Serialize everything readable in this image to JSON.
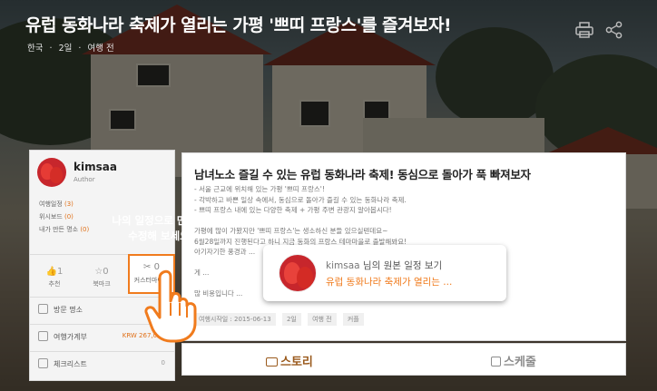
{
  "header": {
    "title": "유럽 동화나라 축제가 열리는 가평 '쁘띠 프랑스'를 즐겨보자!",
    "meta": [
      "한국",
      "·",
      "2일",
      "·",
      "여행 전"
    ]
  },
  "profile": {
    "name": "kimsaa",
    "role": "Author",
    "links": [
      {
        "label": "여행일정",
        "count": "(3)"
      },
      {
        "label": "위시보드",
        "count": "(0)"
      },
      {
        "label": "내가 만든 명소",
        "count": "(0)"
      }
    ],
    "stats": [
      {
        "icon": "like-icon",
        "glyph": "👍",
        "value": "1",
        "label": "추천"
      },
      {
        "icon": "bookmark-icon",
        "glyph": "☆",
        "value": "0",
        "label": "북마크"
      }
    ],
    "customize": {
      "icon": "scissors-icon",
      "glyph": "✂",
      "value": "0",
      "label": "커스터마이즈"
    },
    "rows": [
      {
        "icon": "pin-icon",
        "label": "방문 명소",
        "value": ""
      },
      {
        "icon": "wallet-icon",
        "label": "여행가계부",
        "value": "KRW 267,000"
      },
      {
        "icon": "checklist-icon",
        "label": "체크리스트",
        "value": "0"
      }
    ]
  },
  "article": {
    "title": "남녀노소 즐길 수 있는 유럽 동화나라 축제! 동심으로 돌아가 푹 빠져보자",
    "body": [
      "- 서울 근교에 위치해 있는 가평 '쁘띠 프랑스'!",
      "- 각박하고 바쁜 일상 속에서, 동심으로 돌아가 즐길 수 있는 동화나라 축제.",
      "- 쁘띠 프랑스 내에 있는 다양한 축제 + 가평 주변 관광지 알아봅시다!",
      "",
      "가평에 많이 가봤지만 '쁘띠 프랑스'는 생소하신 분들 있으실텐데요~",
      "6월28일까지 진행된다고 하니 지금 동화의 프랑스 테마마을로 출발해봐요!",
      "아기자기한 풍경과 ...",
      "",
      "게 ...",
      "",
      "많 비용입니다 ..."
    ],
    "tags": [
      "여행시작일 : 2015-06-13",
      "2일",
      "여행 전",
      "커플"
    ],
    "tabs": [
      "스토리",
      "스케줄"
    ]
  },
  "tooltip": {
    "guide": [
      "나의 일정으로 만들어",
      "수정해 보세요"
    ],
    "owner": "kimsaa",
    "owner_suffix": "님의 원본 일정 보기",
    "link": "유럽 동화나라 축제가 열리는 ..."
  },
  "colors": {
    "accent": "#f07b1d",
    "tooltip_bg": "#ffffff"
  }
}
